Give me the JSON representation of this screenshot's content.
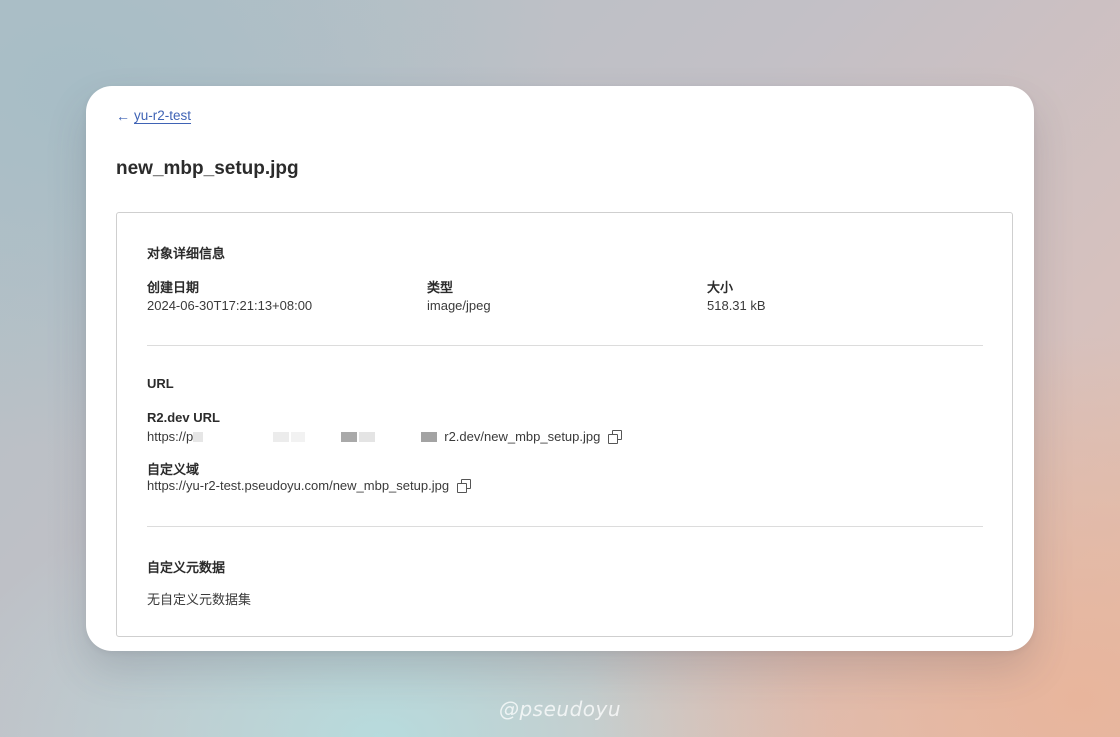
{
  "breadcrumb": {
    "back_label": "yu-r2-test"
  },
  "page": {
    "title": "new_mbp_setup.jpg"
  },
  "object_details": {
    "section_title": "对象详细信息",
    "fields": [
      {
        "label": "创建日期",
        "value": "2024-06-30T17:21:13+08:00"
      },
      {
        "label": "类型",
        "value": "image/jpeg"
      },
      {
        "label": "大小",
        "value": "518.31 kB"
      }
    ]
  },
  "url_section": {
    "section_title": "URL",
    "r2_dev": {
      "label": "R2.dev URL",
      "value_prefix": "https://p",
      "value_suffix": "r2.dev/new_mbp_setup.jpg"
    },
    "custom_domain": {
      "label": "自定义域",
      "value": "https://yu-r2-test.pseudoyu.com/new_mbp_setup.jpg"
    }
  },
  "custom_metadata": {
    "section_title": "自定义元数据",
    "empty_text": "无自定义元数据集"
  },
  "watermark": "@pseudoyu",
  "icons": {
    "back": "arrow-left-icon",
    "copy": "copy-icon"
  }
}
